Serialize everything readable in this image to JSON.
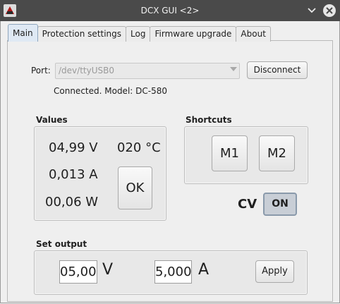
{
  "window": {
    "title": "DCX GUI <2>"
  },
  "tabs": [
    "Main",
    "Protection settings",
    "Log",
    "Firmware upgrade",
    "About"
  ],
  "port": {
    "label": "Port:",
    "value": "/dev/ttyUSB0",
    "button": "Disconnect",
    "status": "Connected. Model: DC-580"
  },
  "values": {
    "title": "Values",
    "voltage": "04,99 V",
    "temperature": "020 °C",
    "current": "0,013 A",
    "power": "00,06 W",
    "ok_button": "OK"
  },
  "shortcuts": {
    "title": "Shortcuts",
    "m1": "M1",
    "m2": "M2"
  },
  "mode": {
    "label": "CV",
    "toggle": "ON"
  },
  "set_output": {
    "title": "Set output",
    "voltage_value": "05,00",
    "voltage_unit": "V",
    "current_value": "5,000",
    "current_unit": "A",
    "apply": "Apply"
  },
  "icons": {
    "app": "app-logo-icon",
    "minimize": "chevron-down-icon",
    "close": "close-icon",
    "dropdown": "dropdown-arrow-icon"
  },
  "colors": {
    "titlebar": "#4a4a4a",
    "active_tab": "#dfe9f4",
    "toggle_on": "#c8ced6"
  }
}
